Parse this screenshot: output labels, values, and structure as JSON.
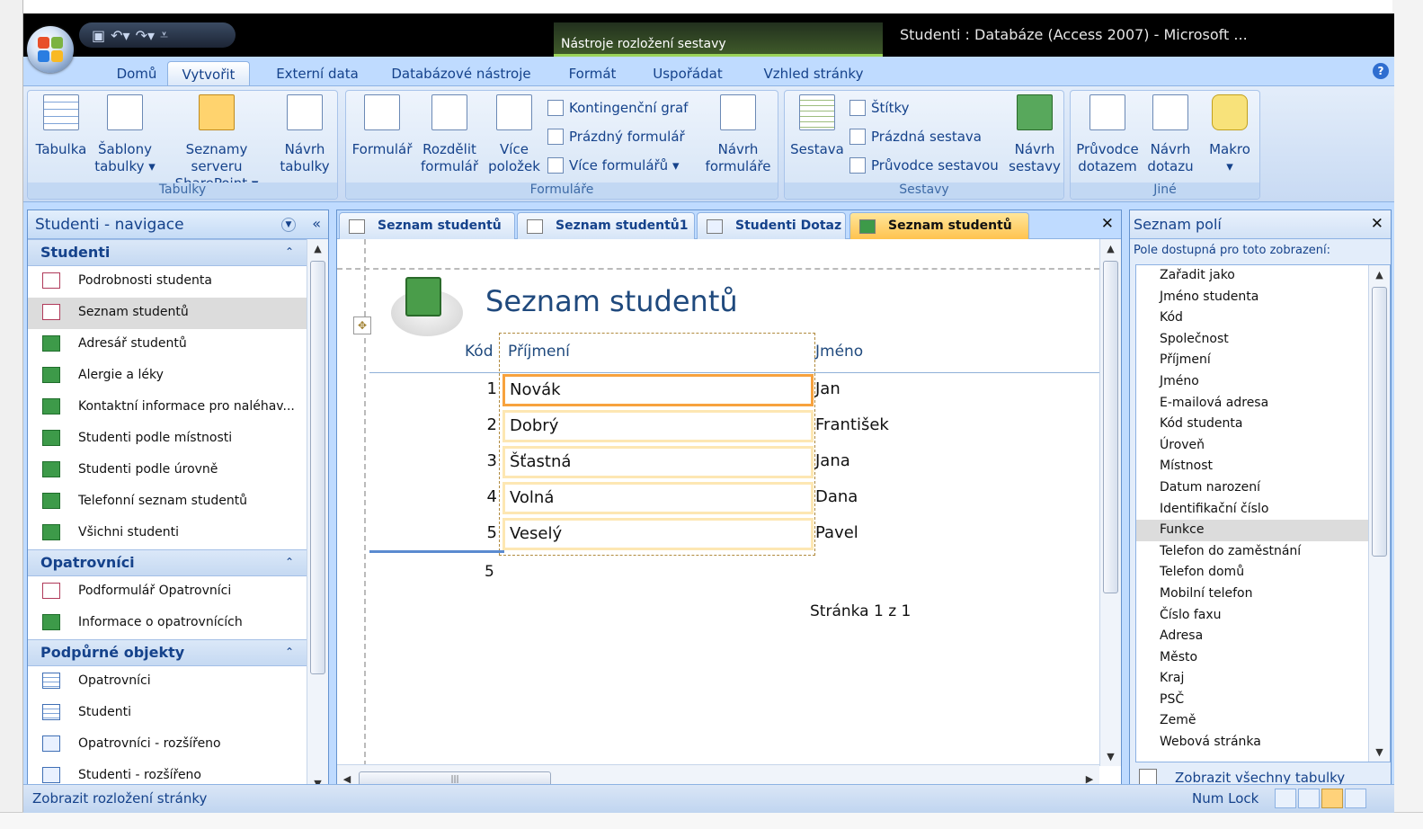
{
  "window": {
    "title": "Studenti : Databáze (Access 2007) - Microsoft ...",
    "context_tab": "Nástroje rozložení sestavy"
  },
  "ribbon_tabs": [
    "Domů",
    "Vytvořit",
    "Externí data",
    "Databázové nástroje",
    "Formát",
    "Uspořádat",
    "Vzhled stránky"
  ],
  "active_tab": "Vytvořit",
  "ribbon": {
    "groups": {
      "tabulky": "Tabulky",
      "formulare": "Formuláře",
      "sestavy": "Sestavy",
      "jine": "Jiné"
    },
    "tabulka": "Tabulka",
    "sablony_1": "Šablony",
    "sablony_2": "tabulky ▾",
    "seznamy_1": "Seznamy serveru",
    "seznamy_2": "SharePoint ▾",
    "navrh_tabulky_1": "Návrh",
    "navrh_tabulky_2": "tabulky",
    "formular": "Formulář",
    "rozdelit_1": "Rozdělit",
    "rozdelit_2": "formulář",
    "vice_1": "Více",
    "vice_2": "položek",
    "kontingencni_graf": "Kontingenční graf",
    "prazdny_formular": "Prázdný formulář",
    "vice_formularu": "Více formulářů ▾",
    "navrh_formulare_1": "Návrh",
    "navrh_formulare_2": "formuláře",
    "sestava": "Sestava",
    "stitky": "Štítky",
    "prazdna_sestava": "Prázdná sestava",
    "pruvodce_sestavou": "Průvodce sestavou",
    "navrh_sestavy_1": "Návrh",
    "navrh_sestavy_2": "sestavy",
    "pruvodce_dotazem_1": "Průvodce",
    "pruvodce_dotazem_2": "dotazem",
    "navrh_dotazu_1": "Návrh",
    "navrh_dotazu_2": "dotazu",
    "makro_1": "Makro",
    "makro_2": "▾"
  },
  "navigation": {
    "title": "Studenti - navigace",
    "categories": [
      {
        "name": "Studenti",
        "items": [
          {
            "label": "Podrobnosti studenta",
            "type": "form"
          },
          {
            "label": "Seznam studentů",
            "type": "form",
            "selected": true
          },
          {
            "label": "Adresář studentů",
            "type": "report"
          },
          {
            "label": "Alergie a léky",
            "type": "report"
          },
          {
            "label": "Kontaktní informace pro naléhav...",
            "type": "report"
          },
          {
            "label": "Studenti podle místnosti",
            "type": "report"
          },
          {
            "label": "Studenti podle úrovně",
            "type": "report"
          },
          {
            "label": "Telefonní seznam studentů",
            "type": "report"
          },
          {
            "label": "Všichni studenti",
            "type": "report"
          }
        ]
      },
      {
        "name": "Opatrovníci",
        "items": [
          {
            "label": "Podformulář Opatrovníci",
            "type": "form"
          },
          {
            "label": "Informace o opatrovnících",
            "type": "report"
          }
        ]
      },
      {
        "name": "Podpůrné objekty",
        "items": [
          {
            "label": "Opatrovníci",
            "type": "table"
          },
          {
            "label": "Studenti",
            "type": "table"
          },
          {
            "label": "Opatrovníci - rozšířeno",
            "type": "query"
          },
          {
            "label": "Studenti - rozšířeno",
            "type": "query"
          }
        ]
      }
    ]
  },
  "doc_tabs": [
    {
      "label": "Seznam studentů",
      "type": "form"
    },
    {
      "label": "Seznam studentů1",
      "type": "form"
    },
    {
      "label": "Studenti Dotaz",
      "type": "query"
    },
    {
      "label": "Seznam studentů",
      "type": "report",
      "active": true
    }
  ],
  "report": {
    "title": "Seznam studentů",
    "headers": {
      "kod": "Kód",
      "prijmeni": "Příjmení",
      "jmeno": "Jméno"
    },
    "rows": [
      {
        "kod": "1",
        "prijmeni": "Novák",
        "jmeno": "Jan"
      },
      {
        "kod": "2",
        "prijmeni": "Dobrý",
        "jmeno": "František"
      },
      {
        "kod": "3",
        "prijmeni": "Šťastná",
        "jmeno": "Jana"
      },
      {
        "kod": "4",
        "prijmeni": "Volná",
        "jmeno": "Dana"
      },
      {
        "kod": "5",
        "prijmeni": "Veselý",
        "jmeno": "Pavel"
      }
    ],
    "count": "5",
    "page_info": "Stránka 1 z 1"
  },
  "field_list": {
    "title": "Seznam polí",
    "subtitle": "Pole dostupná pro toto zobrazení:",
    "fields": [
      "Zařadit jako",
      "Jméno studenta",
      "Kód",
      "Společnost",
      "Příjmení",
      "Jméno",
      "E-mailová adresa",
      "Kód studenta",
      "Úroveň",
      "Místnost",
      "Datum narození",
      "Identifikační číslo",
      "Funkce",
      "Telefon do zaměstnání",
      "Telefon domů",
      "Mobilní telefon",
      "Číslo faxu",
      "Adresa",
      "Město",
      "Kraj",
      "PSČ",
      "Země",
      "Webová stránka"
    ],
    "selected": "Funkce",
    "footer": "Zobrazit všechny tabulky"
  },
  "status": {
    "left": "Zobrazit rozložení stránky",
    "numlock": "Num Lock"
  },
  "colors": {
    "ribbon_bg": "#bfdbff",
    "accent_orange": "#f7a23e",
    "title_blue": "#1f497d"
  }
}
